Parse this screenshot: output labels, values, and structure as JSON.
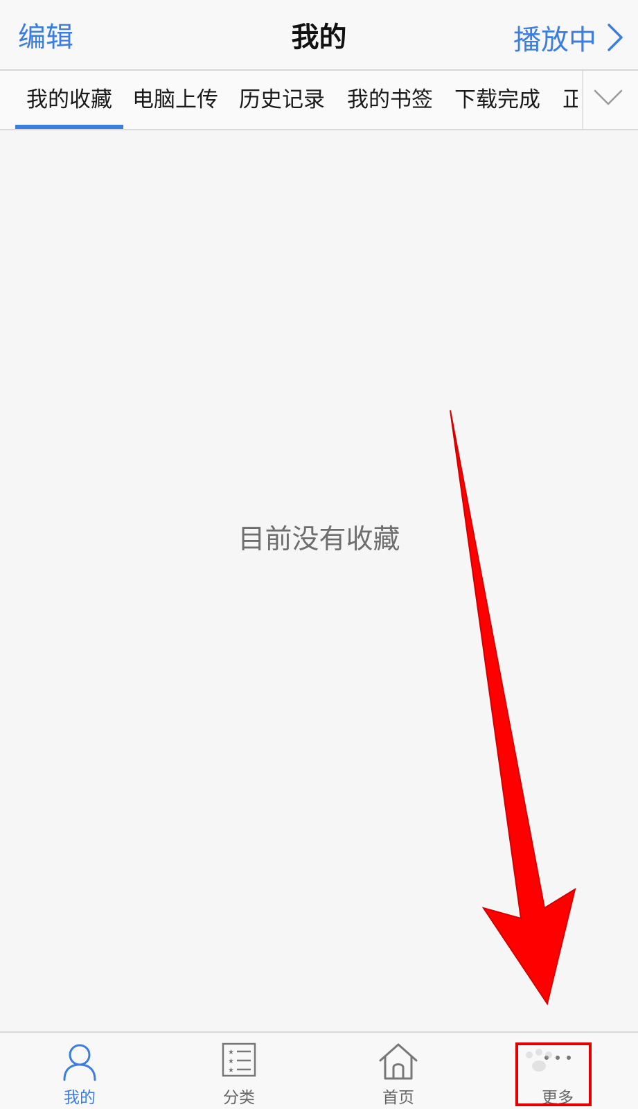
{
  "navbar": {
    "edit_label": "编辑",
    "title": "我的",
    "playing_label": "播放中"
  },
  "tabs": [
    {
      "label": "我的收藏",
      "active": true
    },
    {
      "label": "电脑上传",
      "active": false
    },
    {
      "label": "历史记录",
      "active": false
    },
    {
      "label": "我的书签",
      "active": false
    },
    {
      "label": "下载完成",
      "active": false
    },
    {
      "label": "正",
      "active": false
    }
  ],
  "empty_state": {
    "message": "目前没有收藏"
  },
  "tabbar": [
    {
      "label": "我的",
      "icon": "person-icon",
      "active": true
    },
    {
      "label": "分类",
      "icon": "list-icon",
      "active": false
    },
    {
      "label": "首页",
      "icon": "home-icon",
      "active": false
    },
    {
      "label": "更多",
      "icon": "more-icon",
      "active": false
    }
  ],
  "colors": {
    "accent": "#3b7ee0",
    "annotation": "#ff0000",
    "background": "#f6f6f6"
  }
}
